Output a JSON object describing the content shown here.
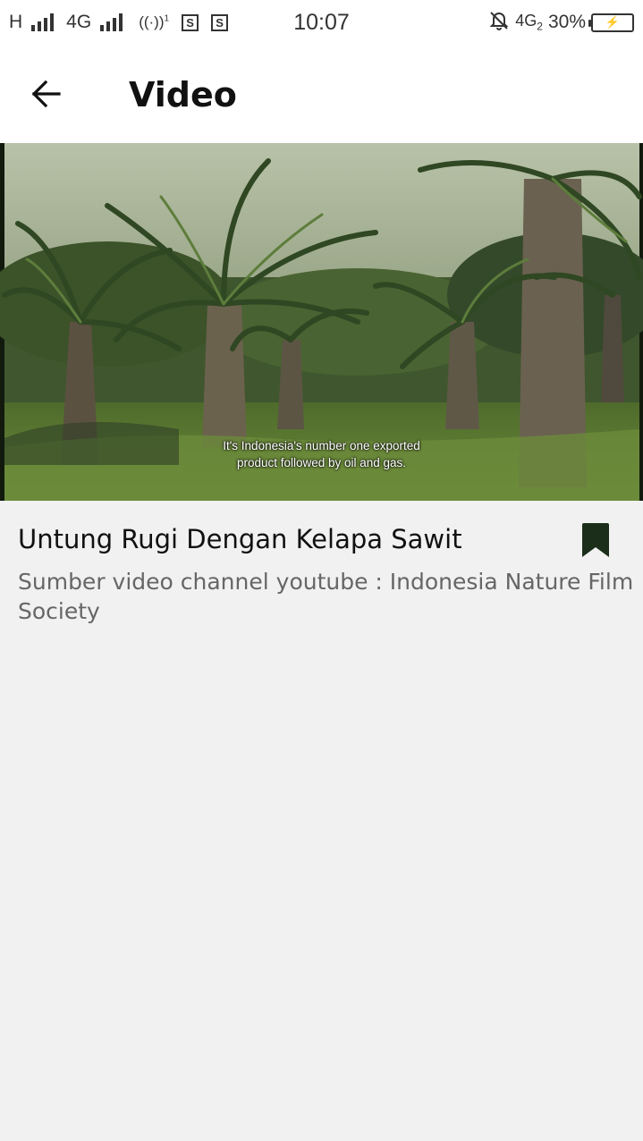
{
  "status_bar": {
    "carrier1_label": "H",
    "carrier2_label": "4G",
    "hotspot_label": "((·))",
    "hotspot_number": "1",
    "box1_label": "S",
    "box2_label": "S",
    "time": "10:07",
    "network2_label": "4G",
    "network2_sub": "2",
    "battery_percent": "30%",
    "battery_symbol": "⚡",
    "icons": [
      "signal-icon",
      "signal-icon",
      "hotspot-icon",
      "notification-s-icon",
      "notification-s-icon",
      "mute-bell-icon",
      "battery-icon"
    ]
  },
  "app_bar": {
    "title": "Video",
    "back_icon": "arrow-left-icon"
  },
  "video": {
    "subtitle_line1": "It's Indonesia's number one exported",
    "subtitle_line2": "product followed by oil and gas."
  },
  "content": {
    "title": "Untung Rugi Dengan Kelapa Sawit",
    "description": "Sumber video channel youtube : Indonesia Nature Film Society",
    "bookmark_icon": "bookmark-icon",
    "bookmark_color": "#1a2e1a"
  }
}
